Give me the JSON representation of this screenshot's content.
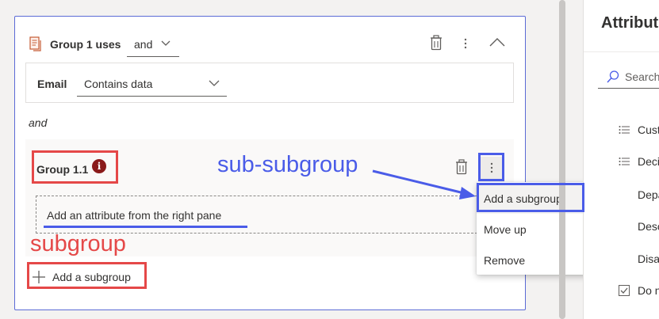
{
  "group": {
    "title": "Group 1 uses",
    "operator": "and",
    "icon": "segment-group-icon"
  },
  "condition": {
    "attribute": "Email",
    "operator": "Contains data"
  },
  "join_label": "and",
  "subgroup": {
    "title": "Group 1.1",
    "info_badge": "i",
    "attribute_placeholder": "Add an attribute from the right pane"
  },
  "add_subgroup_label": "Add a subgroup",
  "context_menu": {
    "items": [
      "Add a subgroup",
      "Move up",
      "Remove"
    ]
  },
  "right_pane": {
    "title": "Attributes",
    "search_placeholder": "Search",
    "items": [
      {
        "label": "Customer",
        "icon": "list-icon"
      },
      {
        "label": "Decision",
        "icon": "list-icon"
      },
      {
        "label": "Department",
        "icon": "none"
      },
      {
        "label": "Description",
        "icon": "none"
      },
      {
        "label": "Disabled",
        "icon": "none"
      },
      {
        "label": "Do not",
        "icon": "checkbox-icon"
      }
    ]
  },
  "annotations": {
    "sub_subgroup": "sub-subgroup",
    "subgroup": "subgroup"
  },
  "colors": {
    "accent_blue": "#4a5ce8",
    "annotation_red": "#e54848",
    "badge_red": "#8a1a1a"
  }
}
